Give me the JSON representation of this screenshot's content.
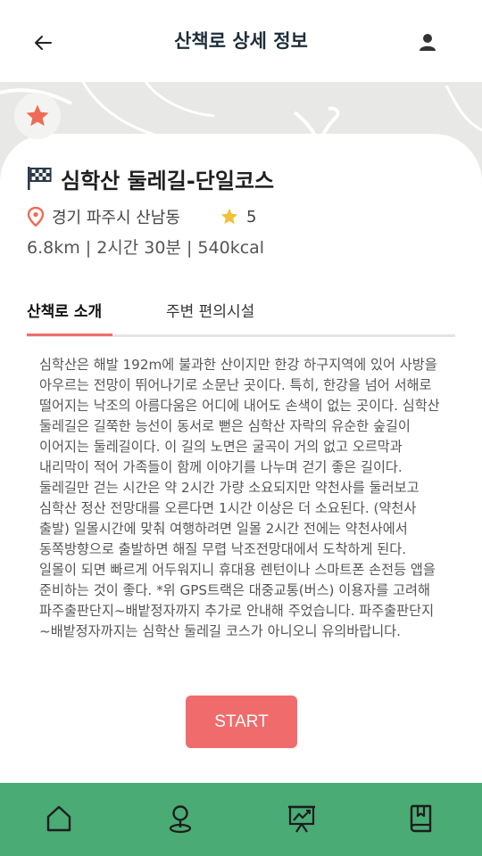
{
  "header": {
    "title": "산책로 상세 정보",
    "back_icon": "arrow-left-icon",
    "user_icon": "user-icon"
  },
  "course": {
    "name": "심학산 둘레길-단일코스",
    "location": "경기 파주시 산남동",
    "rating": "5",
    "stats": "6.8km | 2시간 30분 | 540kcal",
    "favorite": true
  },
  "tabs": [
    {
      "label": "산책로 소개",
      "active": true
    },
    {
      "label": "주변 편의시설",
      "active": false
    }
  ],
  "description": "심학산은 해발 192m에 불과한 산이지만 한강 하구지역에 있어 사방을 아우르는 전망이 뛰어나기로 소문난 곳이다. 특히, 한강을 넘어 서해로 떨어지는 낙조의 아름다움은 어디에 내어도 손색이 없는 곳이다. 심학산 둘레길은 길쭉한 능선이 동서로 뻗은 심학산 자락의 유순한 숲길이 이어지는 둘레길이다. 이 길의 노면은 굴곡이 거의 없고 오르막과 내리막이 적어 가족들이 함께 이야기를 나누며 걷기 좋은 길이다. 둘레길만 걷는 시간은 약 2시간 가량 소요되지만 약천사를 둘러보고 심학산 정산 전망대를 오른다면 1시간 이상은 더 소요된다. (약천사 출발) 일몰시간에 맞춰 여행하려면 일몰 2시간 전에는 약천사에서 동쪽방향으로 출발하면 해질 무렵 낙조전망대에서 도착하게 된다. 일몰이 되면 빠르게 어두워지니 휴대용 렌턴이나 스마트폰 손전등 앱을 준비하는 것이 좋다. *위 GPS트랙은 대중교통(버스) 이용자를 고려해 파주출판단지~배밭정자까지 추가로 안내해 주었습니다. 파주출판단지~배밭정자까지는 심학산 둘레길 코스가 아니오니 유의바랍니다.",
  "start_label": "START",
  "bottom_nav": [
    {
      "icon": "home-icon"
    },
    {
      "icon": "map-pin-icon"
    },
    {
      "icon": "chart-board-icon"
    },
    {
      "icon": "bookmark-book-icon"
    }
  ],
  "colors": {
    "accent": "#ef6e67",
    "start_button": "#f06c6c",
    "nav_bar": "#4aab75",
    "title_text": "#1f2d3a",
    "star": "#f2c037"
  }
}
